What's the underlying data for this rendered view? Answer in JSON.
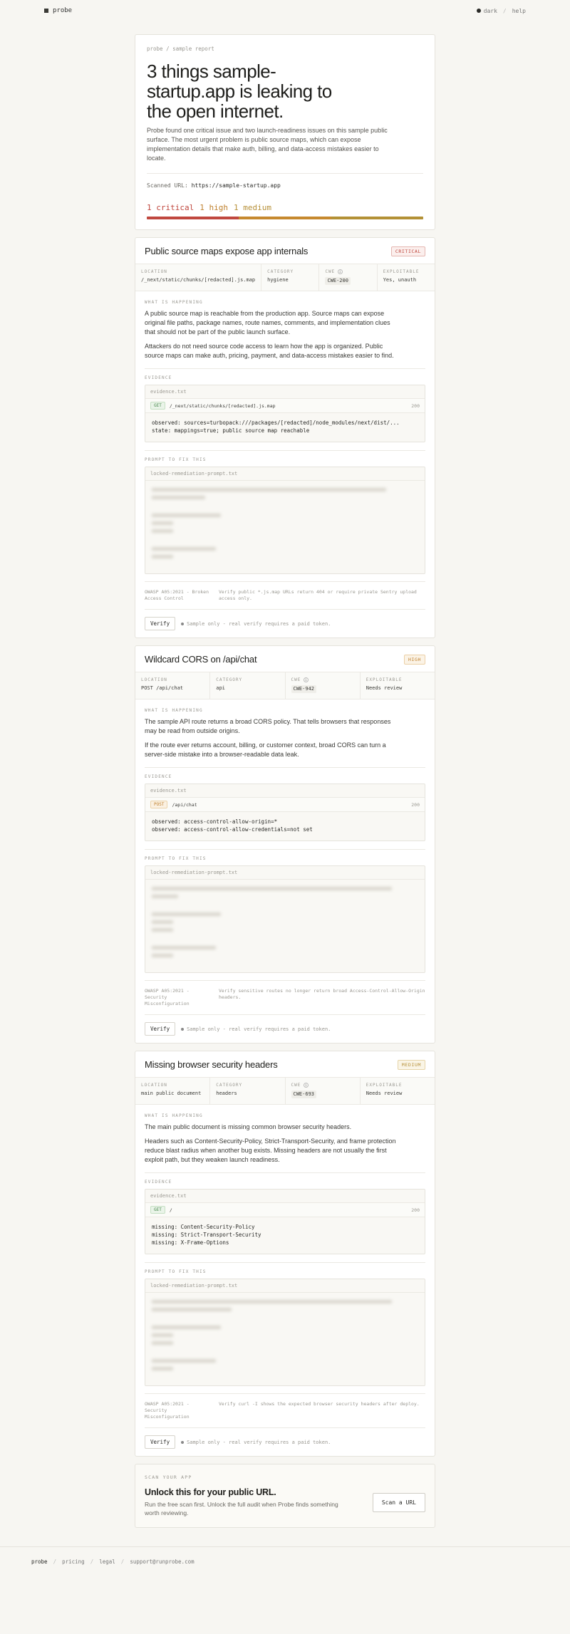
{
  "nav": {
    "brand": "probe",
    "theme": "dark",
    "sep": "/",
    "help": "help"
  },
  "report": {
    "breadcrumb": "probe / sample report",
    "title": "3 things sample-startup.app is leaking to the open internet.",
    "description": "Probe found one critical issue and two launch-readiness issues on this sample public surface. The most urgent problem is public source maps, which can expose implementation details that make auth, billing, and data-access mistakes easier to locate.",
    "scanned_label": "Scanned URL:",
    "scanned_url": "https://sample-startup.app",
    "count_critical": "1 critical",
    "count_high": "1 high",
    "count_medium": "1 medium",
    "severity_split": [
      1,
      1,
      1
    ]
  },
  "labels": {
    "location": "LOCATION",
    "category": "CATEGORY",
    "cwe": "CWE",
    "exploitable": "EXPLOITABLE",
    "what": "WHAT IS HAPPENING",
    "evidence": "EVIDENCE",
    "prompt": "PROMPT TO FIX THIS",
    "evidence_file": "evidence.txt",
    "prompt_file": "locked-remediation-prompt.txt",
    "verify": "Verify",
    "verify_note": "Sample only - real verify requires a paid token."
  },
  "findings": [
    {
      "title": "Public source maps expose app internals",
      "severity": "CRITICAL",
      "location": "/_next/static/chunks/[redacted].js.map",
      "category": "hygiene",
      "cwe": "CWE-200",
      "exploitable": "Yes, unauth",
      "para1": "A public source map is reachable from the production app. Source maps can expose original file paths, package names, route names, comments, and implementation clues that should not be part of the public launch surface.",
      "para2": "Attackers do not need source code access to learn how the app is organized. Public source maps can make auth, pricing, payment, and data-access mistakes easier to find.",
      "method": "GET",
      "path": "/_next/static/chunks/[redacted].js.map",
      "status": "200",
      "evidence": "observed: sources=turbopack:///packages/[redacted]/node_modules/next/dist/...\nstate: mappings=true; public source map reachable",
      "owasp": "OWASP A05:2021 - Broken Access Control",
      "verify_hint": "Verify public *.js.map URLs return 404 or require private Sentry upload access only."
    },
    {
      "title": "Wildcard CORS on /api/chat",
      "severity": "HIGH",
      "location": "POST /api/chat",
      "category": "api",
      "cwe": "CWE-942",
      "exploitable": "Needs review",
      "para1": "The sample API route returns a broad CORS policy. That tells browsers that responses may be read from outside origins.",
      "para2": "If the route ever returns account, billing, or customer context, broad CORS can turn a server-side mistake into a browser-readable data leak.",
      "method": "POST",
      "path": "/api/chat",
      "status": "200",
      "evidence": "observed: access-control-allow-origin=*\nobserved: access-control-allow-credentials=not set",
      "owasp": "OWASP A05:2021 - Security Misconfiguration",
      "verify_hint": "Verify sensitive routes no longer return broad Access-Control-Allow-Origin headers."
    },
    {
      "title": "Missing browser security headers",
      "severity": "MEDIUM",
      "location": "main public document",
      "category": "headers",
      "cwe": "CWE-693",
      "exploitable": "Needs review",
      "para1": "The main public document is missing common browser security headers.",
      "para2": "Headers such as Content-Security-Policy, Strict-Transport-Security, and frame protection reduce blast radius when another bug exists. Missing headers are not usually the first exploit path, but they weaken launch readiness.",
      "method": "GET",
      "path": "/",
      "status": "200",
      "evidence": "missing: Content-Security-Policy\nmissing: Strict-Transport-Security\nmissing: X-Frame-Options",
      "owasp": "OWASP A05:2021 - Security Misconfiguration",
      "verify_hint": "Verify curl -I shows the expected browser security headers after deploy."
    }
  ],
  "cta": {
    "label": "SCAN YOUR APP",
    "title": "Unlock this for your public URL.",
    "description": "Run the free scan first. Unlock the full audit when Probe finds something worth reviewing.",
    "button": "Scan a URL"
  },
  "footer": {
    "brand": "probe",
    "pricing": "pricing",
    "legal": "legal",
    "email": "support@runprobe.com"
  },
  "colors": {
    "critical": "#c0483f",
    "high": "#c0822f",
    "medium": "#b7913a",
    "background": "#f7f6f2"
  }
}
